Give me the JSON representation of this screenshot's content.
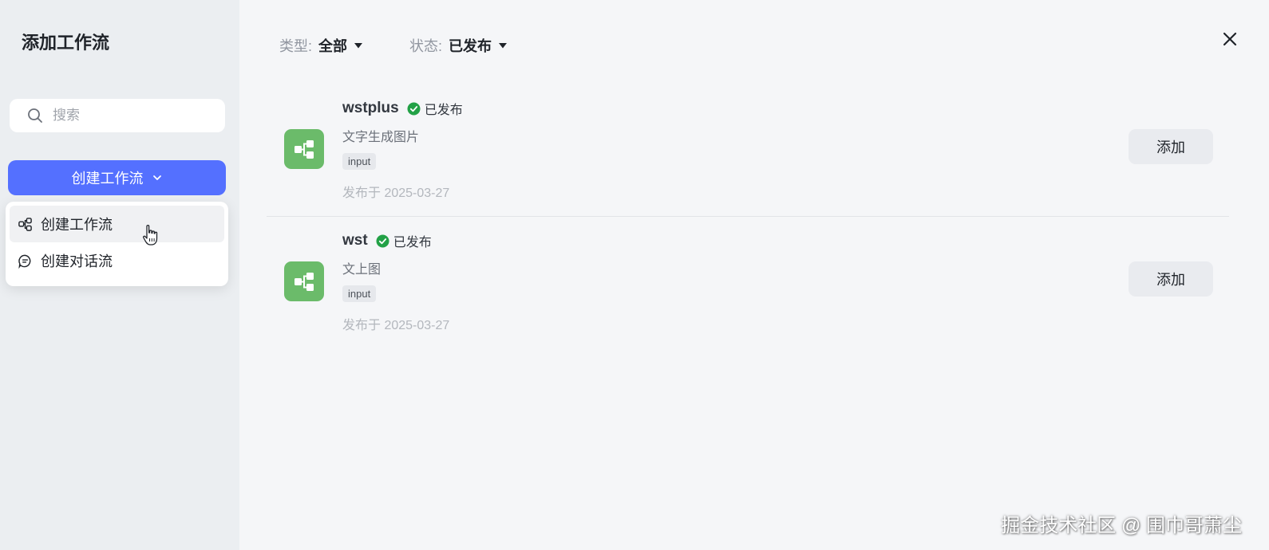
{
  "sidebar": {
    "title": "添加工作流",
    "search": {
      "placeholder": "搜索",
      "value": ""
    },
    "create_button_label": "创建工作流",
    "dropdown": [
      {
        "label": "创建工作流",
        "icon": "workflow-icon"
      },
      {
        "label": "创建对话流",
        "icon": "chat-flow-icon"
      }
    ]
  },
  "filters": {
    "type": {
      "label": "类型:",
      "value": "全部"
    },
    "status": {
      "label": "状态:",
      "value": "已发布"
    }
  },
  "workflows": [
    {
      "name": "wstplus",
      "status": "已发布",
      "description": "文字生成图片",
      "tag": "input",
      "date": "发布于 2025-03-27",
      "add_label": "添加"
    },
    {
      "name": "wst",
      "status": "已发布",
      "description": "文上图",
      "tag": "input",
      "date": "发布于 2025-03-27",
      "add_label": "添加"
    }
  ],
  "watermark": "掘金技术社区 @ 围巾哥萧尘",
  "colors": {
    "primary": "#5470ff",
    "workflow_icon_bg": "#6bbb6a",
    "status_green": "#22a146"
  }
}
